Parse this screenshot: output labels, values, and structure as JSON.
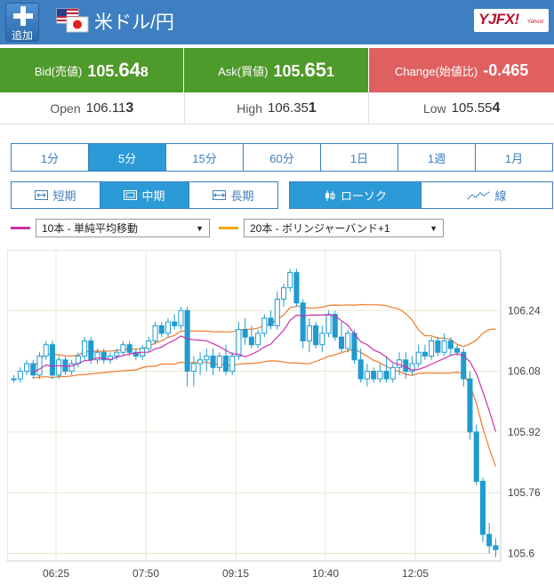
{
  "header": {
    "add_label": "追加",
    "pair_title": "米ドル/円",
    "logo_text": "YJFX!",
    "logo_sub": "Yahoo!"
  },
  "quotes": {
    "bid_label": "Bid(売値)",
    "bid_main": "105.",
    "bid_big": "64",
    "bid_small": "8",
    "ask_label": "Ask(買値)",
    "ask_main": "105.",
    "ask_big": "65",
    "ask_small": "1",
    "change_label": "Change(始値比)",
    "change_value": "-0.465"
  },
  "stats": {
    "open_label": "Open",
    "open_main": "106.11",
    "open_small": "3",
    "high_label": "High",
    "high_main": "106.35",
    "high_small": "1",
    "low_label": "Low",
    "low_main": "105.55",
    "low_small": "4"
  },
  "periods": [
    "1分",
    "5分",
    "15分",
    "60分",
    "1日",
    "1週",
    "1月"
  ],
  "terms": [
    "短期",
    "中期",
    "長期"
  ],
  "chart_types": [
    "ローソク",
    "線"
  ],
  "indicators": {
    "ma_label": "10本 - 単純平均移動",
    "bb_label": "20本 - ボリンジャーバンド+1"
  },
  "colors": {
    "header": "#3d7fc0",
    "bid_ask_bg": "#4e9a2a",
    "change_bg": "#e06060",
    "active": "#2c9ad6",
    "candle": "#1f9bd0",
    "ma_line": "#cc2faa",
    "band_line": "#f07a2a"
  },
  "chart_data": {
    "type": "candlestick",
    "x_ticks": [
      "06:25",
      "07:50",
      "09:15",
      "10:40",
      "12:05"
    ],
    "y_ticks": [
      "106.24",
      "106.08",
      "105.92",
      "105.76",
      "105.6"
    ],
    "ylim": [
      105.58,
      106.4
    ],
    "ohlc": [
      [
        106.06,
        106.07,
        106.05,
        106.06
      ],
      [
        106.06,
        106.09,
        106.05,
        106.08
      ],
      [
        106.08,
        106.11,
        106.07,
        106.1
      ],
      [
        106.1,
        106.11,
        106.06,
        106.07
      ],
      [
        106.07,
        106.13,
        106.06,
        106.12
      ],
      [
        106.12,
        106.16,
        106.11,
        106.15
      ],
      [
        106.15,
        106.16,
        106.06,
        106.07
      ],
      [
        106.07,
        106.12,
        106.06,
        106.11
      ],
      [
        106.11,
        106.12,
        106.07,
        106.08
      ],
      [
        106.08,
        106.11,
        106.07,
        106.1
      ],
      [
        106.1,
        106.13,
        106.09,
        106.12
      ],
      [
        106.12,
        106.17,
        106.11,
        106.16
      ],
      [
        106.16,
        106.17,
        106.1,
        106.11
      ],
      [
        106.11,
        106.14,
        106.1,
        106.13
      ],
      [
        106.13,
        106.14,
        106.1,
        106.11
      ],
      [
        106.11,
        106.13,
        106.1,
        106.12
      ],
      [
        106.12,
        106.14,
        106.11,
        106.13
      ],
      [
        106.13,
        106.16,
        106.12,
        106.15
      ],
      [
        106.15,
        106.16,
        106.12,
        106.13
      ],
      [
        106.13,
        106.14,
        106.11,
        106.12
      ],
      [
        106.12,
        106.15,
        106.11,
        106.14
      ],
      [
        106.14,
        106.17,
        106.13,
        106.16
      ],
      [
        106.16,
        106.21,
        106.15,
        106.2
      ],
      [
        106.2,
        106.21,
        106.17,
        106.18
      ],
      [
        106.18,
        106.22,
        106.17,
        106.21
      ],
      [
        106.21,
        106.23,
        106.19,
        106.2
      ],
      [
        106.2,
        106.25,
        106.19,
        106.24
      ],
      [
        106.24,
        106.25,
        106.04,
        106.08
      ],
      [
        106.08,
        106.12,
        106.04,
        106.1
      ],
      [
        106.1,
        106.13,
        106.07,
        106.11
      ],
      [
        106.11,
        106.14,
        106.08,
        106.12
      ],
      [
        106.12,
        106.14,
        106.07,
        106.09
      ],
      [
        106.09,
        106.13,
        106.08,
        106.12
      ],
      [
        106.12,
        106.15,
        106.07,
        106.08
      ],
      [
        106.08,
        106.13,
        106.07,
        106.12
      ],
      [
        106.12,
        106.21,
        106.11,
        106.19
      ],
      [
        106.19,
        106.22,
        106.15,
        106.17
      ],
      [
        106.17,
        106.2,
        106.14,
        106.15
      ],
      [
        106.15,
        106.19,
        106.14,
        106.18
      ],
      [
        106.18,
        106.23,
        106.17,
        106.22
      ],
      [
        106.22,
        106.24,
        106.19,
        106.2
      ],
      [
        106.2,
        106.29,
        106.19,
        106.27
      ],
      [
        106.27,
        106.31,
        106.25,
        106.3
      ],
      [
        106.3,
        106.35,
        106.29,
        106.34
      ],
      [
        106.34,
        106.35,
        106.25,
        106.26
      ],
      [
        106.26,
        106.27,
        106.14,
        106.16
      ],
      [
        106.16,
        106.22,
        106.13,
        106.2
      ],
      [
        106.2,
        106.21,
        106.14,
        106.15
      ],
      [
        106.15,
        106.2,
        106.13,
        106.18
      ],
      [
        106.18,
        106.24,
        106.17,
        106.23
      ],
      [
        106.23,
        106.24,
        106.16,
        106.17
      ],
      [
        106.17,
        106.21,
        106.13,
        106.14
      ],
      [
        106.14,
        106.19,
        106.13,
        106.18
      ],
      [
        106.18,
        106.19,
        106.1,
        106.11
      ],
      [
        106.11,
        106.14,
        106.05,
        106.06
      ],
      [
        106.06,
        106.1,
        106.04,
        106.08
      ],
      [
        106.08,
        106.09,
        106.05,
        106.06
      ],
      [
        106.06,
        106.1,
        106.05,
        106.08
      ],
      [
        106.08,
        106.12,
        106.05,
        106.06
      ],
      [
        106.06,
        106.1,
        106.05,
        106.09
      ],
      [
        106.09,
        106.13,
        106.07,
        106.11
      ],
      [
        106.11,
        106.13,
        106.06,
        106.08
      ],
      [
        106.08,
        106.12,
        106.07,
        106.1
      ],
      [
        106.1,
        106.15,
        106.09,
        106.13
      ],
      [
        106.13,
        106.15,
        106.11,
        106.12
      ],
      [
        106.12,
        106.17,
        106.11,
        106.16
      ],
      [
        106.16,
        106.17,
        106.12,
        106.13
      ],
      [
        106.13,
        106.18,
        106.12,
        106.16
      ],
      [
        106.16,
        106.17,
        106.12,
        106.14
      ],
      [
        106.14,
        106.15,
        106.12,
        106.13
      ],
      [
        106.13,
        106.14,
        106.04,
        106.06
      ],
      [
        106.06,
        106.08,
        105.9,
        105.92
      ],
      [
        105.92,
        105.94,
        105.78,
        105.79
      ],
      [
        105.79,
        105.8,
        105.63,
        105.65
      ],
      [
        105.65,
        105.68,
        105.6,
        105.62
      ],
      [
        105.62,
        105.64,
        105.59,
        105.61
      ]
    ]
  }
}
